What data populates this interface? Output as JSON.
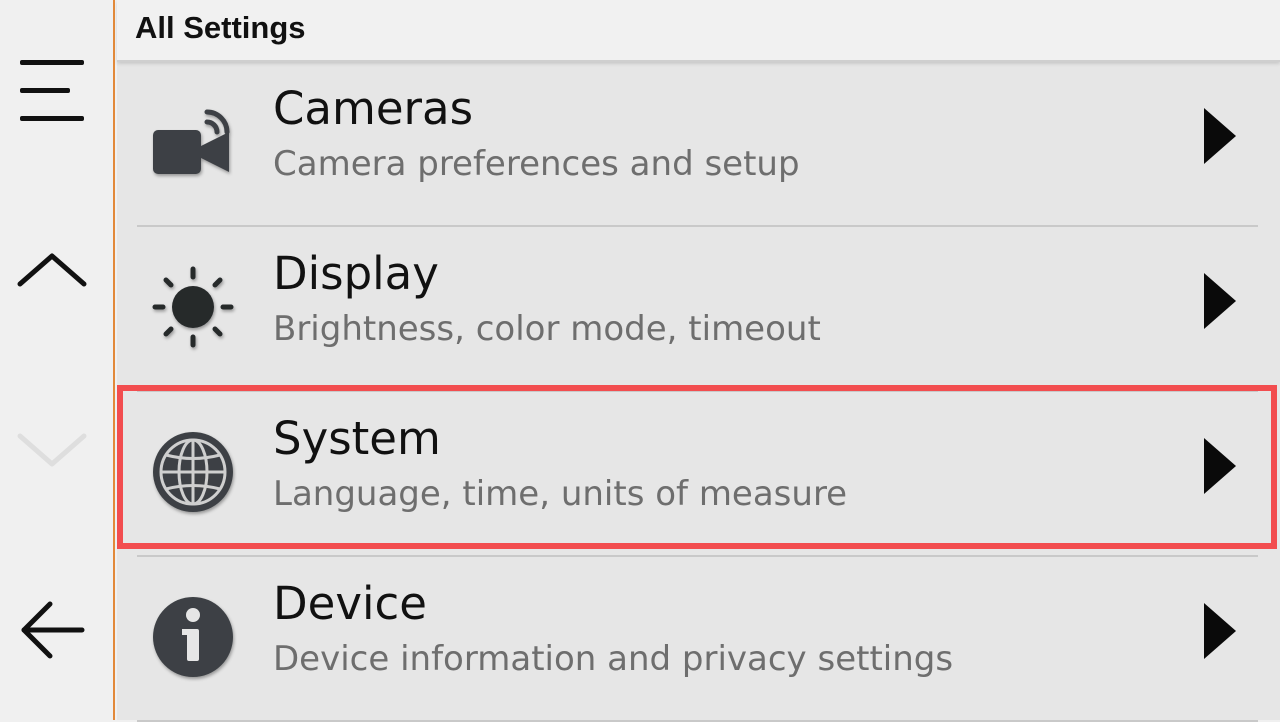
{
  "header": {
    "title": "All Settings"
  },
  "sidebar": {
    "buttons": [
      {
        "name": "menu",
        "icon": "hamburger-menu-icon"
      },
      {
        "name": "up",
        "icon": "chevron-up-icon"
      },
      {
        "name": "down",
        "icon": "chevron-down-icon",
        "disabled": true
      },
      {
        "name": "back",
        "icon": "arrow-left-icon"
      }
    ]
  },
  "settings": [
    {
      "title": "Cameras",
      "subtitle": "Camera preferences and setup",
      "icon": "camera-icon"
    },
    {
      "title": "Display",
      "subtitle": "Brightness, color mode, timeout",
      "icon": "sun-icon"
    },
    {
      "title": "System",
      "subtitle": "Language, time, units of measure",
      "icon": "globe-icon",
      "highlighted": true
    },
    {
      "title": "Device",
      "subtitle": "Device information and privacy settings",
      "icon": "info-icon"
    }
  ],
  "colors": {
    "accent_border": "#e2893a",
    "highlight": "#f24d4f",
    "icon_dark": "#3c4044"
  }
}
